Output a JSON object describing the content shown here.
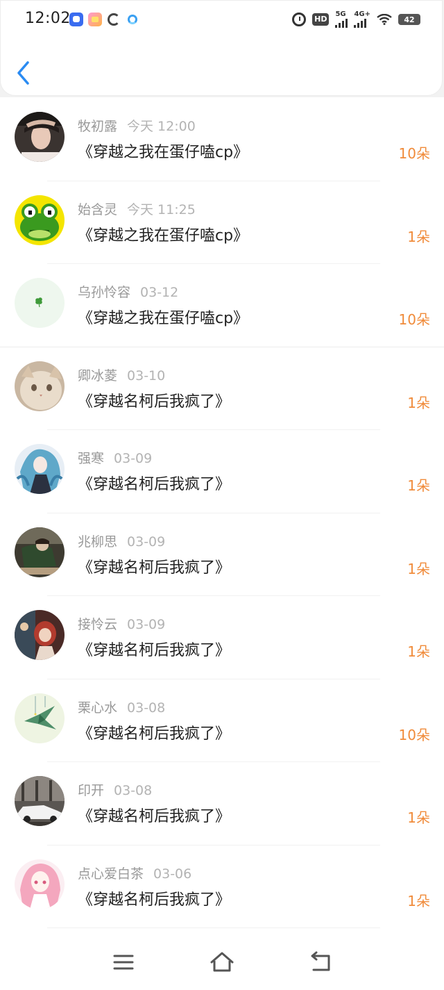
{
  "status_bar": {
    "time": "12:02",
    "battery": "42",
    "network_1": "5G",
    "network_2": "4G+",
    "hd_label": "HD"
  },
  "colors": {
    "accent": "#2a8bf2",
    "amount": "#f08b3a",
    "name": "#999999",
    "title": "#222222"
  },
  "rows": [
    {
      "name": "牧初露",
      "date": "今天 12:00",
      "title": "《穿越之我在蛋仔嗑cp》",
      "amount": "10朵",
      "avatar_icon": "girl-portrait-avatar"
    },
    {
      "name": "始含灵",
      "date": "今天 11:25",
      "title": "《穿越之我在蛋仔嗑cp》",
      "amount": "1朵",
      "avatar_icon": "frog-avatar"
    },
    {
      "name": "乌孙怜容",
      "date": "03-12",
      "title": "《穿越之我在蛋仔嗑cp》",
      "amount": "10朵",
      "avatar_icon": "clover-avatar"
    },
    {
      "name": "卿冰菱",
      "date": "03-10",
      "title": "《穿越名柯后我疯了》",
      "amount": "1朵",
      "avatar_icon": "cat-avatar"
    },
    {
      "name": "强寒",
      "date": "03-09",
      "title": "《穿越名柯后我疯了》",
      "amount": "1朵",
      "avatar_icon": "anime-girl-avatar"
    },
    {
      "name": "兆柳思",
      "date": "03-09",
      "title": "《穿越名柯后我疯了》",
      "amount": "1朵",
      "avatar_icon": "anime-soldier-avatar"
    },
    {
      "name": "接怜云",
      "date": "03-09",
      "title": "《穿越名柯后我疯了》",
      "amount": "1朵",
      "avatar_icon": "red-hair-avatar"
    },
    {
      "name": "栗心水",
      "date": "03-08",
      "title": "《穿越名柯后我疯了》",
      "amount": "10朵",
      "avatar_icon": "paper-crane-avatar"
    },
    {
      "name": "印开",
      "date": "03-08",
      "title": "《穿越名柯后我疯了》",
      "amount": "1朵",
      "avatar_icon": "car-avatar"
    },
    {
      "name": "点心爱白茶",
      "date": "03-06",
      "title": "《穿越名柯后我疯了》",
      "amount": "1朵",
      "avatar_icon": "pink-anime-avatar"
    }
  ]
}
